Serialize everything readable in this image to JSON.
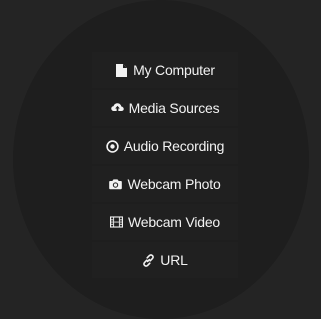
{
  "colors": {
    "background": "#242424",
    "circle": "#1e1e1e",
    "item_background": "#202020",
    "text": "#f2f2f2"
  },
  "menu": {
    "items": [
      {
        "label": "My Computer",
        "icon": "file-icon"
      },
      {
        "label": "Media Sources",
        "icon": "cloud-upload-icon"
      },
      {
        "label": "Audio Recording",
        "icon": "record-circle-icon"
      },
      {
        "label": "Webcam Photo",
        "icon": "camera-icon"
      },
      {
        "label": "Webcam Video",
        "icon": "film-icon"
      },
      {
        "label": "URL",
        "icon": "link-icon"
      }
    ]
  }
}
